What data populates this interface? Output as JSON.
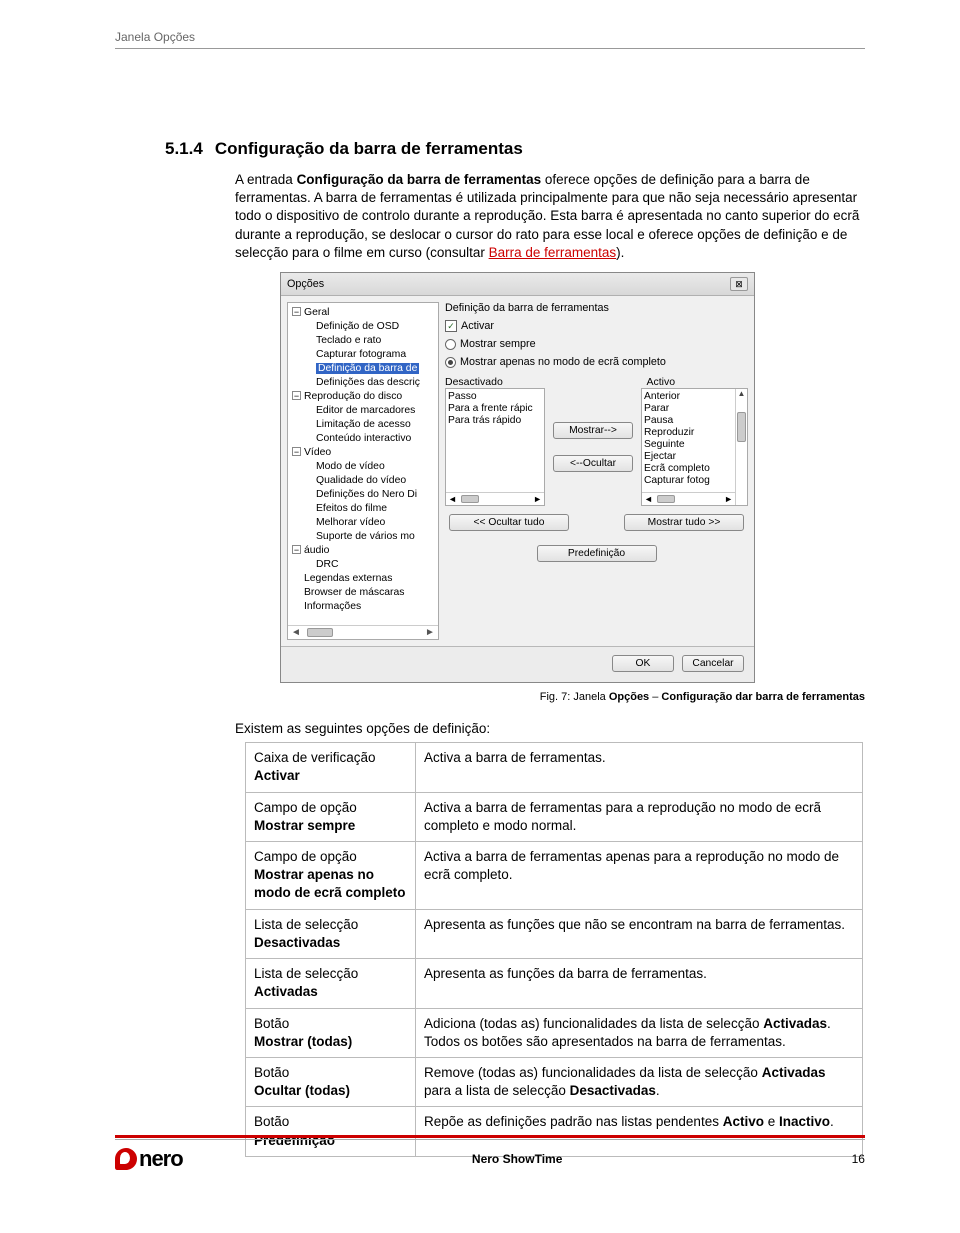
{
  "header": {
    "text": "Janela Opções"
  },
  "section": {
    "number": "5.1.4",
    "title": "Configuração da barra de ferramentas"
  },
  "para1_a": "A entrada ",
  "para1_b": "Configuração da barra de ferramentas",
  "para1_c": " oferece opções de definição para a barra de ferramentas. A barra de ferramentas é utilizada principalmente para que não seja necessário apresentar  todo o dispositivo de controlo durante a reprodução. Esta barra é apresentada no canto superior do ecrã durante a reprodução, se deslocar o cursor do rato para esse local e oferece opções de definição e de selecção para o filme em curso (consultar ",
  "para1_link": "Barra de ferramentas",
  "para1_d": ").",
  "dialog": {
    "title": "Opções",
    "close_glyph": "⊠",
    "tree": {
      "groups": [
        {
          "label": "Geral",
          "children": [
            "Definição de OSD",
            "Teclado e rato",
            "Capturar fotograma",
            "Definição da barra de",
            "Definições das descriç"
          ]
        },
        {
          "label": "Reprodução do disco",
          "children": [
            "Editor de marcadores",
            "Limitação de acesso",
            "Conteúdo interactivo"
          ]
        },
        {
          "label": "Vídeo",
          "children": [
            "Modo de vídeo",
            "Qualidade do vídeo",
            "Definições do Nero Di",
            "Efeitos do filme",
            "Melhorar vídeo",
            "Suporte de vários mo"
          ]
        },
        {
          "label": "áudio",
          "children": [
            "DRC"
          ]
        }
      ],
      "extra": [
        "Legendas externas",
        "Browser de máscaras",
        "Informações"
      ],
      "selected": "Definição da barra de"
    },
    "right": {
      "heading": "Definição da barra de ferramentas",
      "checkbox": "Activar",
      "radio1": "Mostrar sempre",
      "radio2": "Mostrar apenas no modo de ecrã completo",
      "col_left": "Desactivado",
      "col_right": "Activo",
      "left_items": [
        "Passo",
        "Para a frente rápic",
        "Para trás rápido"
      ],
      "right_items": [
        "Anterior",
        "Parar",
        "Pausa",
        "Reproduzir",
        "Seguinte",
        "Ejectar",
        "Ecrã completo",
        "Capturar fotog"
      ],
      "btn_show": "Mostrar-->",
      "btn_hide": "<--Ocultar",
      "btn_hide_all": "<< Ocultar tudo",
      "btn_show_all": "Mostrar tudo >>",
      "btn_predef": "Predefinição"
    },
    "footer": {
      "ok": "OK",
      "cancel": "Cancelar"
    }
  },
  "figcaption": {
    "prefix": "Fig. 7: Janela ",
    "bold1": "Opções",
    "dash": " – ",
    "bold2": "Configuração dar barra de ferramentas"
  },
  "options_intro": "Existem as seguintes opções de definição:",
  "table": [
    {
      "l1": "Caixa de verificação",
      "l2": "Activar",
      "desc": "Activa a barra de ferramentas."
    },
    {
      "l1": "Campo de opção",
      "l2": "Mostrar sempre",
      "desc": "Activa a barra de ferramentas  para a reprodução no modo de ecrã completo e modo normal."
    },
    {
      "l1": "Campo de opção",
      "l2": "Mostrar apenas no modo de ecrã completo",
      "desc": "Activa a barra de ferramentas apenas para a reprodução no modo de ecrã completo."
    },
    {
      "l1": "Lista de selecção",
      "l2": "Desactivadas",
      "desc": "Apresenta as funções que não se encontram na barra de ferramentas."
    },
    {
      "l1": "Lista de selecção",
      "l2": "Activadas",
      "desc": "Apresenta as funções da barra de ferramentas."
    },
    {
      "l1": "Botão",
      "l2": "Mostrar (todas)",
      "desc": "Adiciona (todas as) funcionalidades da lista de selecção <b>Activadas</b>.<br>Todos os botões são apresentados na barra de ferramentas."
    },
    {
      "l1": "Botão",
      "l2": "Ocultar (todas)",
      "desc": "Remove (todas as) funcionalidades da lista de selecção <b>Activadas</b> para a lista de selecção <b>Desactivadas</b>."
    },
    {
      "l1": "Botão",
      "l2": "Predefinição",
      "desc": "Repõe as definições padrão nas listas pendentes <b>Activo</b> e <b>Inactivo</b>."
    }
  ],
  "footer": {
    "logo_text": "nero",
    "center": "Nero ShowTime",
    "page": "16"
  }
}
